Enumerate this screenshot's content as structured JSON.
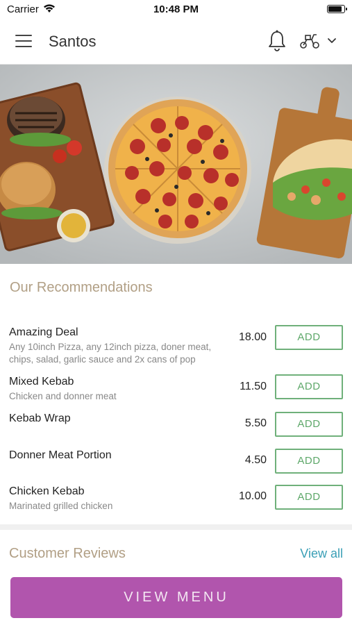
{
  "status_bar": {
    "carrier": "Carrier",
    "time": "10:48 PM"
  },
  "header": {
    "title": "Santos"
  },
  "hero": {
    "image": "food-platter-pizza-burgers-kebab"
  },
  "recommendations": {
    "title": "Our Recommendations",
    "button_label": "ADD",
    "items": [
      {
        "name": "Amazing Deal",
        "description": "Any 10inch Pizza, any 12inch pizza, doner meat, chips, salad, garlic sauce and 2x cans of pop",
        "price": "18.00"
      },
      {
        "name": "Mixed Kebab",
        "description": "Chicken and donner meat",
        "price": "11.50"
      },
      {
        "name": "Kebab Wrap",
        "description": "",
        "price": "5.50"
      },
      {
        "name": "Donner Meat Portion",
        "description": "",
        "price": "4.50"
      },
      {
        "name": "Chicken Kebab",
        "description": "Marinated grilled chicken",
        "price": "10.00"
      }
    ]
  },
  "reviews": {
    "title": "Customer Reviews",
    "view_all": "View all"
  },
  "footer": {
    "view_menu": "VIEW MENU"
  },
  "colors": {
    "accent_gold": "#b19f85",
    "add_green": "#5ea86a",
    "link_blue": "#3a9fb6",
    "menu_purple": "#b155ad"
  }
}
